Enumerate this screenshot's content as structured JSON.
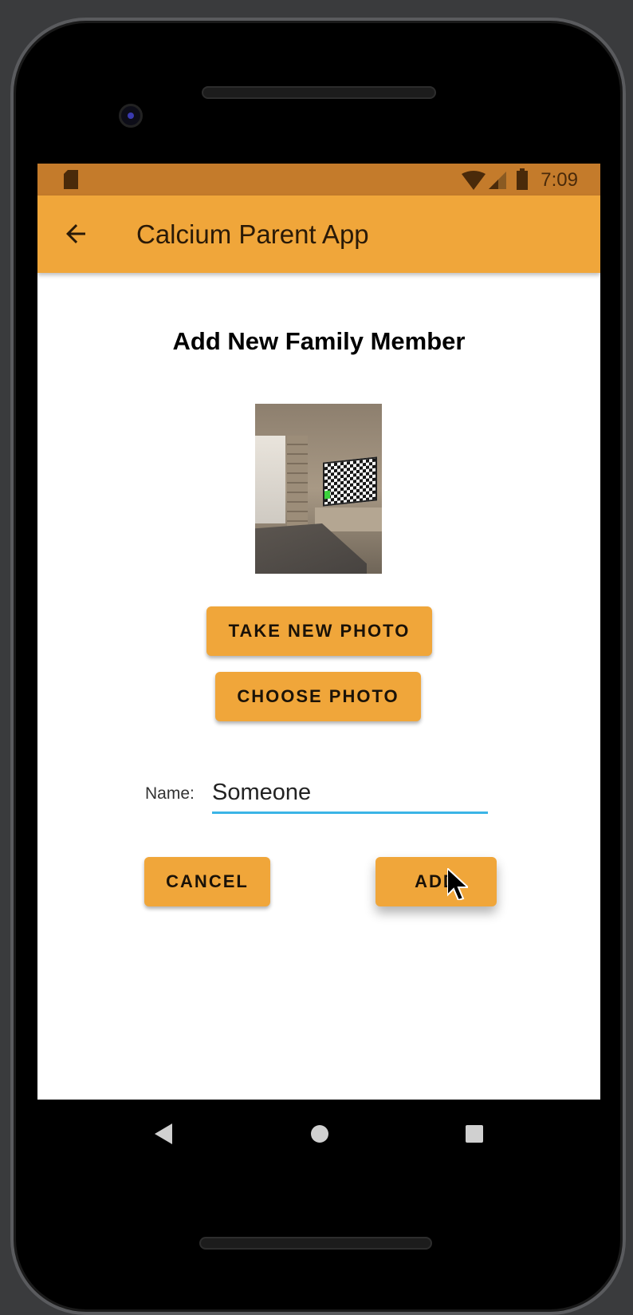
{
  "status_bar": {
    "time": "7:09",
    "icons": [
      "sd-card-icon",
      "wifi-icon",
      "cellular-icon",
      "battery-icon"
    ]
  },
  "app_bar": {
    "title": "Calcium Parent App",
    "back_icon": "arrow-back-icon"
  },
  "main": {
    "heading": "Add New Family Member",
    "photo_icon": "member-photo",
    "take_photo_label": "TAKE NEW PHOTO",
    "choose_photo_label": "CHOOSE PHOTO",
    "name_label": "Name:",
    "name_value": "Someone",
    "cancel_label": "CANCEL",
    "add_label": "ADD"
  },
  "nav_bar": {
    "icons": [
      "nav-back-icon",
      "nav-home-icon",
      "nav-recents-icon"
    ]
  },
  "colors": {
    "primary": "#f0a63a",
    "status_bar": "#c47b2b",
    "input_underline": "#3bb4e6"
  }
}
